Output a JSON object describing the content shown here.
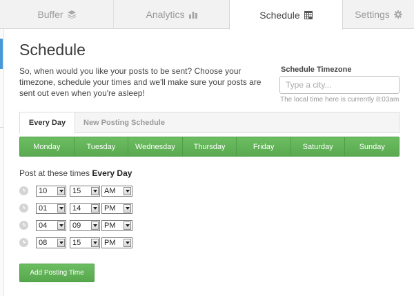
{
  "nav": {
    "tabs": [
      {
        "label": "Buffer",
        "icon": "stack-icon"
      },
      {
        "label": "Analytics",
        "icon": "bar-chart-icon"
      },
      {
        "label": "Schedule",
        "icon": "calendar-icon",
        "active": true
      },
      {
        "label": "Settings",
        "icon": "gear-icon"
      }
    ]
  },
  "page": {
    "title": "Schedule",
    "intro": "So, when would you like your posts to be sent? Choose your timezone, schedule your times and we'll make sure your posts are sent out even when you're asleep!"
  },
  "timezone": {
    "label": "Schedule Timezone",
    "placeholder": "Type a city...",
    "value": "",
    "note": "The local time here is currently 8:03am"
  },
  "schedule_tabs": [
    "Every Day",
    "New Posting Schedule"
  ],
  "days": [
    "Monday",
    "Tuesday",
    "Wednesday",
    "Thursday",
    "Friday",
    "Saturday",
    "Sunday"
  ],
  "post_times": {
    "label_prefix": "Post at these times",
    "label_emphasis": "Every Day",
    "times": [
      {
        "hour": "10",
        "minute": "15",
        "ampm": "AM"
      },
      {
        "hour": "01",
        "minute": "14",
        "ampm": "PM"
      },
      {
        "hour": "04",
        "minute": "09",
        "ampm": "PM"
      },
      {
        "hour": "08",
        "minute": "15",
        "ampm": "PM"
      }
    ]
  },
  "buttons": {
    "add_time": "Add Posting Time"
  },
  "colors": {
    "accent_green": "#63b35a",
    "accent_blue": "#4a97d8"
  }
}
